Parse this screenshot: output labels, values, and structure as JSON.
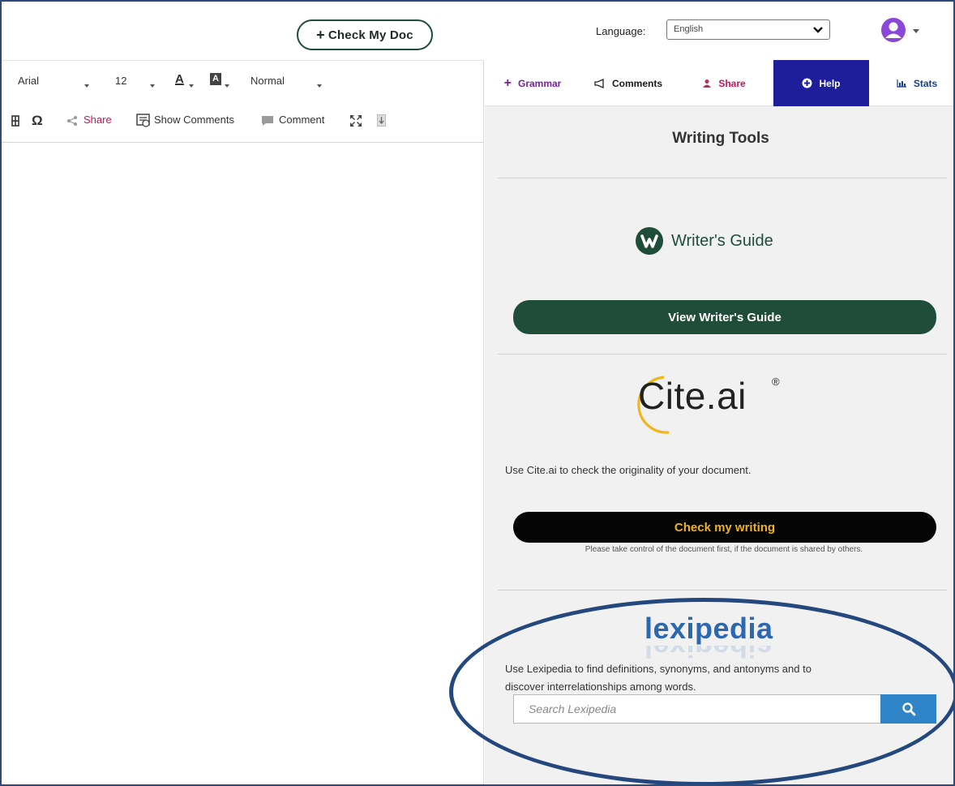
{
  "header": {
    "check_button": "Check My Doc",
    "language_label": "Language:",
    "language_value": "English",
    "avatar_icon": "user-avatar-icon"
  },
  "editor_toolbar": {
    "font_family": "Arial",
    "font_size": "12",
    "style": "Normal",
    "share": "Share",
    "show_comments": "Show Comments",
    "comment": "Comment",
    "omega": "Ω"
  },
  "tabs": [
    {
      "label": "Grammar",
      "icon": "+",
      "color": "#7a1fa2"
    },
    {
      "label": "Comments",
      "icon": "megaphone-icon",
      "color": "#1a1a1a"
    },
    {
      "label": "Share",
      "icon": "users-icon",
      "color": "#c2185b"
    },
    {
      "label": "Help",
      "icon": "plus-circle-icon",
      "color": "#ffffff"
    },
    {
      "label": "Stats",
      "icon": "bar-chart-icon",
      "color": "#1a3f8f"
    }
  ],
  "panel": {
    "title": "Writing Tools",
    "writers_guide": {
      "name": "Writer's Guide",
      "button": "View Writer's Guide"
    },
    "cite": {
      "logo": "Cite.ai",
      "reg_mark": "®",
      "description": "Use Cite.ai to check the originality of your document.",
      "button": "Check my writing",
      "note": "Please take control of the document first, if the document is shared by others."
    },
    "lexipedia": {
      "logo": "lexipedia",
      "description_line1": "Use Lexipedia to find definitions, synonyms, and antonyms and to",
      "description_line2": "discover interrelationships among words.",
      "search_placeholder": "Search Lexipedia"
    }
  },
  "colors": {
    "brand_green": "#1f4d3a",
    "help_tab": "#1e1e9a",
    "cite_button_text": "#f0b418",
    "lexipedia_blue": "#2c67b2",
    "annotation_ellipse": "#24477e"
  }
}
